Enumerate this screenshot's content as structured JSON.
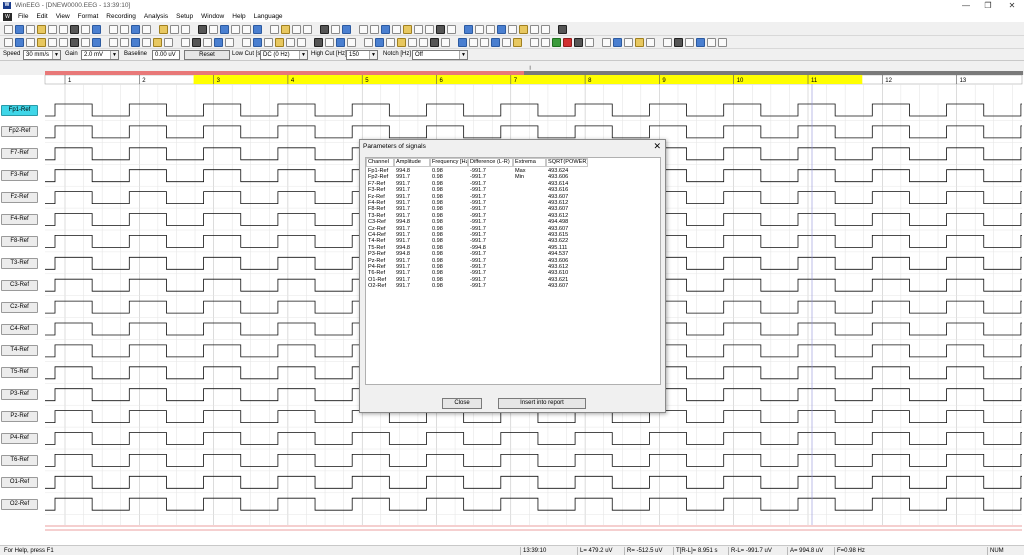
{
  "window": {
    "app_name": "WinEEG",
    "title": "WinEEG - [DNEW0000.EEG - 13:39:10]",
    "minimize": "—",
    "restore": "❐",
    "close": "✕"
  },
  "menu": {
    "icon_label": "W",
    "items": [
      "File",
      "Edit",
      "View",
      "Format",
      "Recording",
      "Analysis",
      "Setup",
      "Window",
      "Help",
      "Language"
    ]
  },
  "controls": {
    "speed_label": "Speed",
    "speed_value": "30 mm/s",
    "gain_label": "Gain",
    "gain_value": "2.0 mV",
    "baseline_label": "Baseline",
    "baseline_value": "0.00 uV",
    "reset_label": "Reset",
    "lowcut_label": "Low Cut [s]",
    "lowcut_value": "DC (0 Hz)",
    "highcut_label": "High Cut [Hz]",
    "highcut_value": "150",
    "notch_label": "Notch [Hz]",
    "notch_value": "Off"
  },
  "recording": {
    "progress_fraction": 0.49
  },
  "timeline": {
    "labels": [
      "1",
      "2",
      "3",
      "4",
      "5",
      "6",
      "7",
      "8",
      "9",
      "10",
      "11",
      "12",
      "13"
    ],
    "highlight_from": 2,
    "highlight_to": 10,
    "highlight_color": "#ffff00"
  },
  "channels": [
    "Fp1-Ref",
    "Fp2-Ref",
    "F7-Ref",
    "F3-Ref",
    "Fz-Ref",
    "F4-Ref",
    "F8-Ref",
    "T3-Ref",
    "C3-Ref",
    "Cz-Ref",
    "C4-Ref",
    "T4-Ref",
    "T5-Ref",
    "P3-Ref",
    "Pz-Ref",
    "P4-Ref",
    "T6-Ref",
    "O1-Ref",
    "O2-Ref"
  ],
  "active_channel": "Fp1-Ref",
  "dialog": {
    "title": "Parameters of signals",
    "close_glyph": "✕",
    "headers": [
      "Channel",
      "Amplitude",
      "Frequency [Hz]",
      "Difference (L-R)",
      "Extrema",
      "SQRT(POWER)"
    ],
    "rows": [
      [
        "Fp1-Ref",
        "994.8",
        "0.98",
        "-991.7",
        "Max",
        "493.624"
      ],
      [
        "Fp2-Ref",
        "991.7",
        "0.98",
        "-991.7",
        "Min",
        "493.606"
      ],
      [
        "F7-Ref",
        "991.7",
        "0.98",
        "-991.7",
        "",
        "493.614"
      ],
      [
        "F3-Ref",
        "991.7",
        "0.98",
        "-991.7",
        "",
        "493.616"
      ],
      [
        "Fz-Ref",
        "991.7",
        "0.98",
        "-991.7",
        "",
        "493.607"
      ],
      [
        "F4-Ref",
        "991.7",
        "0.98",
        "-991.7",
        "",
        "493.612"
      ],
      [
        "F8-Ref",
        "991.7",
        "0.98",
        "-991.7",
        "",
        "493.607"
      ],
      [
        "T3-Ref",
        "991.7",
        "0.98",
        "-991.7",
        "",
        "493.612"
      ],
      [
        "C3-Ref",
        "994.8",
        "0.98",
        "-991.7",
        "",
        "494.498"
      ],
      [
        "Cz-Ref",
        "991.7",
        "0.98",
        "-991.7",
        "",
        "493.607"
      ],
      [
        "C4-Ref",
        "991.7",
        "0.98",
        "-991.7",
        "",
        "493.615"
      ],
      [
        "T4-Ref",
        "991.7",
        "0.98",
        "-991.7",
        "",
        "493.622"
      ],
      [
        "T5-Ref",
        "994.8",
        "0.98",
        "-994.8",
        "",
        "495.111"
      ],
      [
        "P3-Ref",
        "994.8",
        "0.98",
        "-991.7",
        "",
        "494.537"
      ],
      [
        "Pz-Ref",
        "991.7",
        "0.98",
        "-991.7",
        "",
        "493.606"
      ],
      [
        "P4-Ref",
        "991.7",
        "0.98",
        "-991.7",
        "",
        "493.612"
      ],
      [
        "T6-Ref",
        "991.7",
        "0.98",
        "-991.7",
        "",
        "493.610"
      ],
      [
        "O1-Ref",
        "991.7",
        "0.98",
        "-991.7",
        "",
        "493.621"
      ],
      [
        "O2-Ref",
        "991.7",
        "0.98",
        "-991.7",
        "",
        "493.607"
      ]
    ],
    "close_button": "Close",
    "insert_button": "Insert into report"
  },
  "status": {
    "help": "For Help, press F1",
    "time": "13:39:10",
    "left": "L= 479.2 uV",
    "right": "R= -512.5 uV",
    "interval": "T[R-L]= 8.951 s",
    "diff": "R-L= -991.7 uV",
    "amp": "A= 994.8 uV",
    "freq": "F=0.98 Hz",
    "num": "NUM"
  }
}
